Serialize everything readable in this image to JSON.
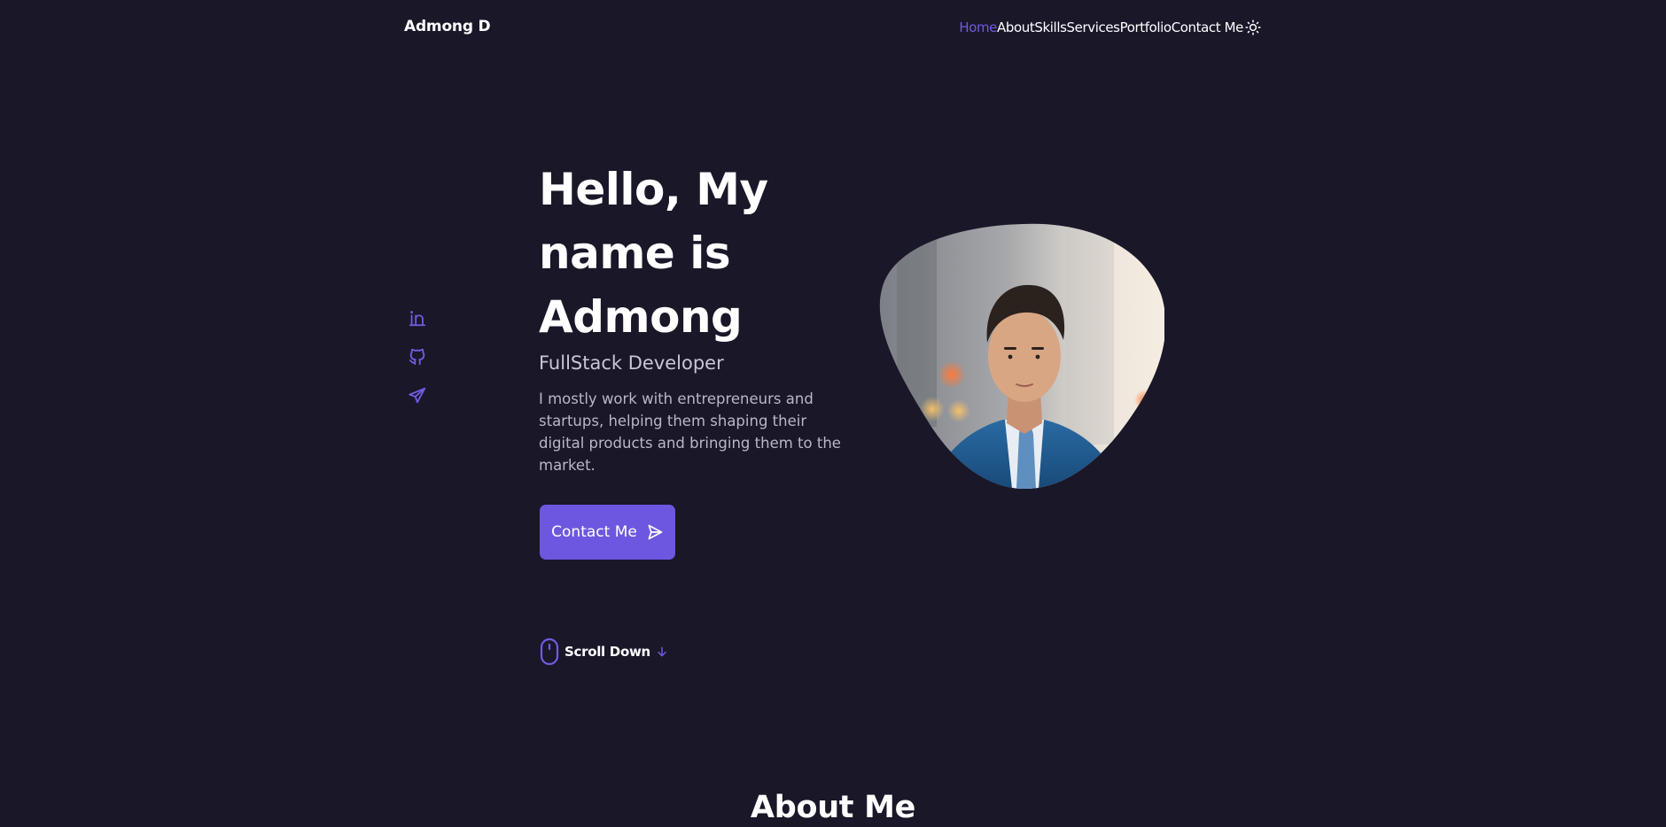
{
  "header": {
    "logo": "Admong D",
    "nav": [
      {
        "label": "Home",
        "active": true
      },
      {
        "label": "About"
      },
      {
        "label": "Skills"
      },
      {
        "label": "Services"
      },
      {
        "label": "Portfolio"
      },
      {
        "label": "Contact Me"
      }
    ],
    "theme_toggle_icon": "sun-icon"
  },
  "social": [
    {
      "name": "linkedin-icon"
    },
    {
      "name": "github-icon"
    },
    {
      "name": "telegram-icon"
    }
  ],
  "hero": {
    "title_lines": [
      "Hello, My",
      "name is",
      "Admong"
    ],
    "subtitle": "FullStack Developer",
    "description": "I mostly work with entrepreneurs and startups, helping them shaping their digital products and bringing them to the market.",
    "button_label": "Contact Me",
    "button_icon": "send-icon",
    "avatar": "portrait-photo"
  },
  "scroll": {
    "label": "Scroll Down",
    "mouse_icon": "mouse-icon",
    "arrow_icon": "arrow-down-icon"
  },
  "about": {
    "title": "About Me"
  },
  "colors": {
    "background": "#1a1729",
    "accent": "#6e57e0",
    "text": "#ffffff",
    "text_muted": "#b9b7c7"
  }
}
